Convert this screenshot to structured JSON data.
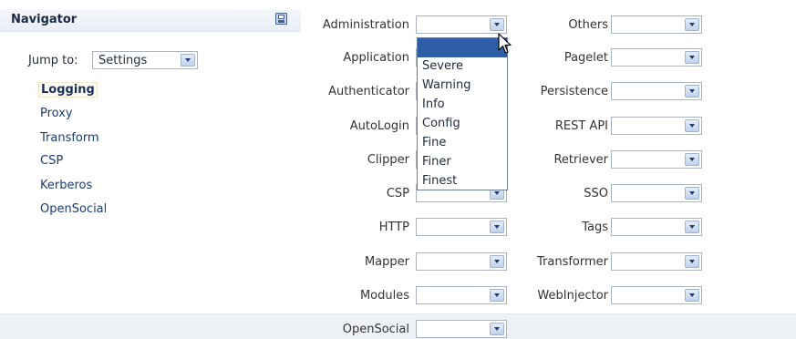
{
  "navigator": {
    "title": "Navigator",
    "jump_to_label": "Jump to:",
    "jump_to_value": "Settings",
    "items": [
      {
        "label": "Logging",
        "active": true
      },
      {
        "label": "Proxy"
      },
      {
        "label": "Transform"
      },
      {
        "label": "CSP"
      },
      {
        "label": "Kerberos"
      },
      {
        "label": "OpenSocial"
      }
    ]
  },
  "left_fields": [
    {
      "label": "Administration",
      "value": ""
    },
    {
      "label": "Application",
      "value": ""
    },
    {
      "label": "Authenticator",
      "value": ""
    },
    {
      "label": "AutoLogin",
      "value": ""
    },
    {
      "label": "Clipper",
      "value": ""
    },
    {
      "label": "CSP",
      "value": ""
    },
    {
      "label": "HTTP",
      "value": ""
    },
    {
      "label": "Mapper",
      "value": ""
    },
    {
      "label": "Modules",
      "value": ""
    },
    {
      "label": "OpenSocial",
      "value": ""
    }
  ],
  "right_fields": [
    {
      "label": "Others",
      "value": ""
    },
    {
      "label": "Pagelet",
      "value": ""
    },
    {
      "label": "Persistence",
      "value": ""
    },
    {
      "label": "REST API",
      "value": ""
    },
    {
      "label": "Retriever",
      "value": ""
    },
    {
      "label": "SSO",
      "value": ""
    },
    {
      "label": "Tags",
      "value": ""
    },
    {
      "label": "Transformer",
      "value": ""
    },
    {
      "label": "WebInjector",
      "value": ""
    }
  ],
  "dropdown_options": [
    "",
    "Severe",
    "Warning",
    "Info",
    "Config",
    "Fine",
    "Finer",
    "Finest"
  ]
}
